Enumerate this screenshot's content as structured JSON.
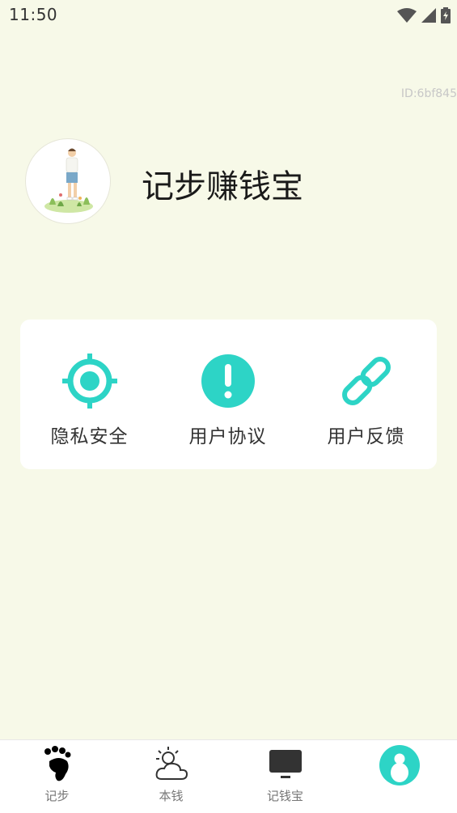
{
  "status_bar": {
    "time": "11:50",
    "icons": [
      "wifi-icon",
      "cellular-signal-icon",
      "battery-icon"
    ]
  },
  "profile": {
    "id_text": "ID:6bf845",
    "app_title": "记步赚钱宝",
    "avatar": "avatar-illustration"
  },
  "menu": {
    "items": [
      {
        "label": "隐私安全",
        "icon": "target-icon"
      },
      {
        "label": "用户协议",
        "icon": "exclamation-icon"
      },
      {
        "label": "用户反馈",
        "icon": "link-icon"
      }
    ]
  },
  "bottom_nav": {
    "items": [
      {
        "label": "记步",
        "icon": "footprint-icon"
      },
      {
        "label": "本钱",
        "icon": "weather-icon"
      },
      {
        "label": "记钱宝",
        "icon": "monitor-icon"
      },
      {
        "label": "",
        "icon": "profile-icon",
        "active": true
      }
    ]
  },
  "colors": {
    "background": "#f7f9e8",
    "accent": "#2dd4c6",
    "card": "#ffffff",
    "nav_label": "#777777"
  }
}
